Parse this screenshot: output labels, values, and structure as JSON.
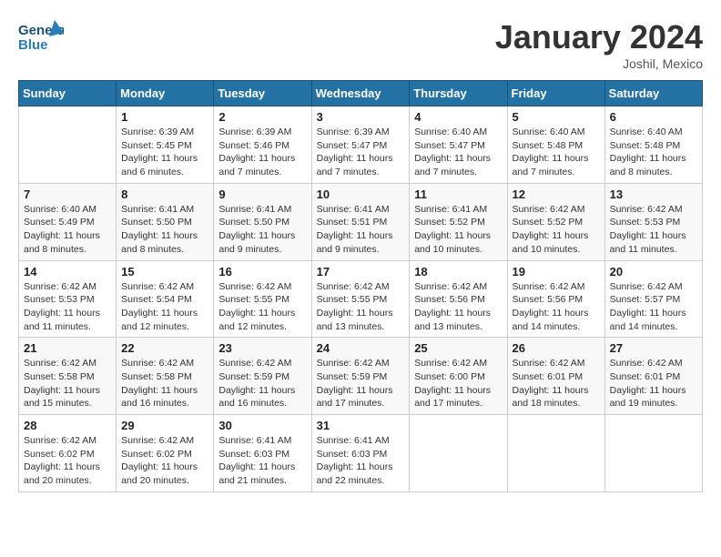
{
  "header": {
    "logo_line1": "General",
    "logo_line2": "Blue",
    "month_title": "January 2024",
    "location": "Joshil, Mexico"
  },
  "weekdays": [
    "Sunday",
    "Monday",
    "Tuesday",
    "Wednesday",
    "Thursday",
    "Friday",
    "Saturday"
  ],
  "weeks": [
    [
      {
        "day": "",
        "info": ""
      },
      {
        "day": "1",
        "info": "Sunrise: 6:39 AM\nSunset: 5:45 PM\nDaylight: 11 hours\nand 6 minutes."
      },
      {
        "day": "2",
        "info": "Sunrise: 6:39 AM\nSunset: 5:46 PM\nDaylight: 11 hours\nand 7 minutes."
      },
      {
        "day": "3",
        "info": "Sunrise: 6:39 AM\nSunset: 5:47 PM\nDaylight: 11 hours\nand 7 minutes."
      },
      {
        "day": "4",
        "info": "Sunrise: 6:40 AM\nSunset: 5:47 PM\nDaylight: 11 hours\nand 7 minutes."
      },
      {
        "day": "5",
        "info": "Sunrise: 6:40 AM\nSunset: 5:48 PM\nDaylight: 11 hours\nand 7 minutes."
      },
      {
        "day": "6",
        "info": "Sunrise: 6:40 AM\nSunset: 5:48 PM\nDaylight: 11 hours\nand 8 minutes."
      }
    ],
    [
      {
        "day": "7",
        "info": "Sunrise: 6:40 AM\nSunset: 5:49 PM\nDaylight: 11 hours\nand 8 minutes."
      },
      {
        "day": "8",
        "info": "Sunrise: 6:41 AM\nSunset: 5:50 PM\nDaylight: 11 hours\nand 8 minutes."
      },
      {
        "day": "9",
        "info": "Sunrise: 6:41 AM\nSunset: 5:50 PM\nDaylight: 11 hours\nand 9 minutes."
      },
      {
        "day": "10",
        "info": "Sunrise: 6:41 AM\nSunset: 5:51 PM\nDaylight: 11 hours\nand 9 minutes."
      },
      {
        "day": "11",
        "info": "Sunrise: 6:41 AM\nSunset: 5:52 PM\nDaylight: 11 hours\nand 10 minutes."
      },
      {
        "day": "12",
        "info": "Sunrise: 6:42 AM\nSunset: 5:52 PM\nDaylight: 11 hours\nand 10 minutes."
      },
      {
        "day": "13",
        "info": "Sunrise: 6:42 AM\nSunset: 5:53 PM\nDaylight: 11 hours\nand 11 minutes."
      }
    ],
    [
      {
        "day": "14",
        "info": "Sunrise: 6:42 AM\nSunset: 5:53 PM\nDaylight: 11 hours\nand 11 minutes."
      },
      {
        "day": "15",
        "info": "Sunrise: 6:42 AM\nSunset: 5:54 PM\nDaylight: 11 hours\nand 12 minutes."
      },
      {
        "day": "16",
        "info": "Sunrise: 6:42 AM\nSunset: 5:55 PM\nDaylight: 11 hours\nand 12 minutes."
      },
      {
        "day": "17",
        "info": "Sunrise: 6:42 AM\nSunset: 5:55 PM\nDaylight: 11 hours\nand 13 minutes."
      },
      {
        "day": "18",
        "info": "Sunrise: 6:42 AM\nSunset: 5:56 PM\nDaylight: 11 hours\nand 13 minutes."
      },
      {
        "day": "19",
        "info": "Sunrise: 6:42 AM\nSunset: 5:56 PM\nDaylight: 11 hours\nand 14 minutes."
      },
      {
        "day": "20",
        "info": "Sunrise: 6:42 AM\nSunset: 5:57 PM\nDaylight: 11 hours\nand 14 minutes."
      }
    ],
    [
      {
        "day": "21",
        "info": "Sunrise: 6:42 AM\nSunset: 5:58 PM\nDaylight: 11 hours\nand 15 minutes."
      },
      {
        "day": "22",
        "info": "Sunrise: 6:42 AM\nSunset: 5:58 PM\nDaylight: 11 hours\nand 16 minutes."
      },
      {
        "day": "23",
        "info": "Sunrise: 6:42 AM\nSunset: 5:59 PM\nDaylight: 11 hours\nand 16 minutes."
      },
      {
        "day": "24",
        "info": "Sunrise: 6:42 AM\nSunset: 5:59 PM\nDaylight: 11 hours\nand 17 minutes."
      },
      {
        "day": "25",
        "info": "Sunrise: 6:42 AM\nSunset: 6:00 PM\nDaylight: 11 hours\nand 17 minutes."
      },
      {
        "day": "26",
        "info": "Sunrise: 6:42 AM\nSunset: 6:01 PM\nDaylight: 11 hours\nand 18 minutes."
      },
      {
        "day": "27",
        "info": "Sunrise: 6:42 AM\nSunset: 6:01 PM\nDaylight: 11 hours\nand 19 minutes."
      }
    ],
    [
      {
        "day": "28",
        "info": "Sunrise: 6:42 AM\nSunset: 6:02 PM\nDaylight: 11 hours\nand 20 minutes."
      },
      {
        "day": "29",
        "info": "Sunrise: 6:42 AM\nSunset: 6:02 PM\nDaylight: 11 hours\nand 20 minutes."
      },
      {
        "day": "30",
        "info": "Sunrise: 6:41 AM\nSunset: 6:03 PM\nDaylight: 11 hours\nand 21 minutes."
      },
      {
        "day": "31",
        "info": "Sunrise: 6:41 AM\nSunset: 6:03 PM\nDaylight: 11 hours\nand 22 minutes."
      },
      {
        "day": "",
        "info": ""
      },
      {
        "day": "",
        "info": ""
      },
      {
        "day": "",
        "info": ""
      }
    ]
  ]
}
